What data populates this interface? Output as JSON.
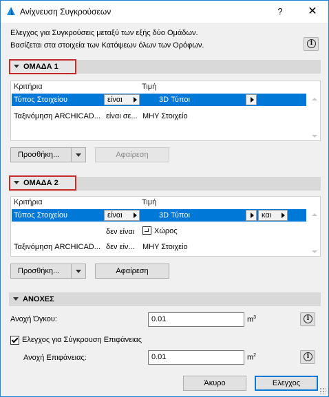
{
  "window": {
    "title": "Ανίχνευση Συγκρούσεων",
    "help_label": "?",
    "close_label": "✕"
  },
  "description": {
    "line1": "Ελεγχος για Συγκρούσεις μεταξύ των εξής δύο Ομάδων.",
    "line2": "Βασίζεται στα στοιχεία των Κατόψεων όλων των Ορόφων."
  },
  "icons": {
    "info": "i"
  },
  "group1": {
    "heading": "ΟΜΑΔΑ 1",
    "columns": {
      "criteria": "Κριτήρια",
      "value": "Τιμή"
    },
    "rows": [
      {
        "criterion": "Τύπος Στοιχείου",
        "operator": "είναι",
        "value": "3D Τύποι",
        "selected": true
      },
      {
        "criterion": "Ταξινόμηση ARCHICAD...",
        "operator": "είναι σε...",
        "value": "ΜΗΥ Στοιχείο",
        "selected": false
      }
    ],
    "add_label": "Προσθήκη...",
    "remove_label": "Αφαίρεση",
    "remove_enabled": false
  },
  "group2": {
    "heading": "ΟΜΑΔΑ 2",
    "columns": {
      "criteria": "Κριτήρια",
      "value": "Τιμή"
    },
    "rows": [
      {
        "criterion": "Τύπος Στοιχείου",
        "operator": "είναι",
        "value": "3D Τύποι",
        "conjunction": "και",
        "selected": true
      },
      {
        "criterion": "",
        "operator": "δεν είναι",
        "value": "Χώρος",
        "selected": false
      },
      {
        "criterion": "Ταξινόμηση ARCHICAD...",
        "operator": "δεν είν...",
        "value": "ΜΗΥ Στοιχείο",
        "selected": false
      }
    ],
    "add_label": "Προσθήκη...",
    "remove_label": "Αφαίρεση",
    "remove_enabled": true
  },
  "tolerances": {
    "heading": "ΑΝΟΧΕΣ",
    "volume_label": "Ανοχή Όγκου:",
    "volume_value": "0.01",
    "volume_unit": "m",
    "volume_unit_exp": "3",
    "surface_check_label": "Ελεγχος για Σύγκρουση Επιφάνειας",
    "surface_check_checked": true,
    "surface_label": "Ανοχή Επιφάνειας:",
    "surface_value": "0.01",
    "surface_unit": "m",
    "surface_unit_exp": "2"
  },
  "footer": {
    "cancel_label": "Άκυρο",
    "check_label": "Ελεγχος"
  },
  "colors": {
    "selection": "#0078d7",
    "highlight_border": "#c42b2b"
  }
}
